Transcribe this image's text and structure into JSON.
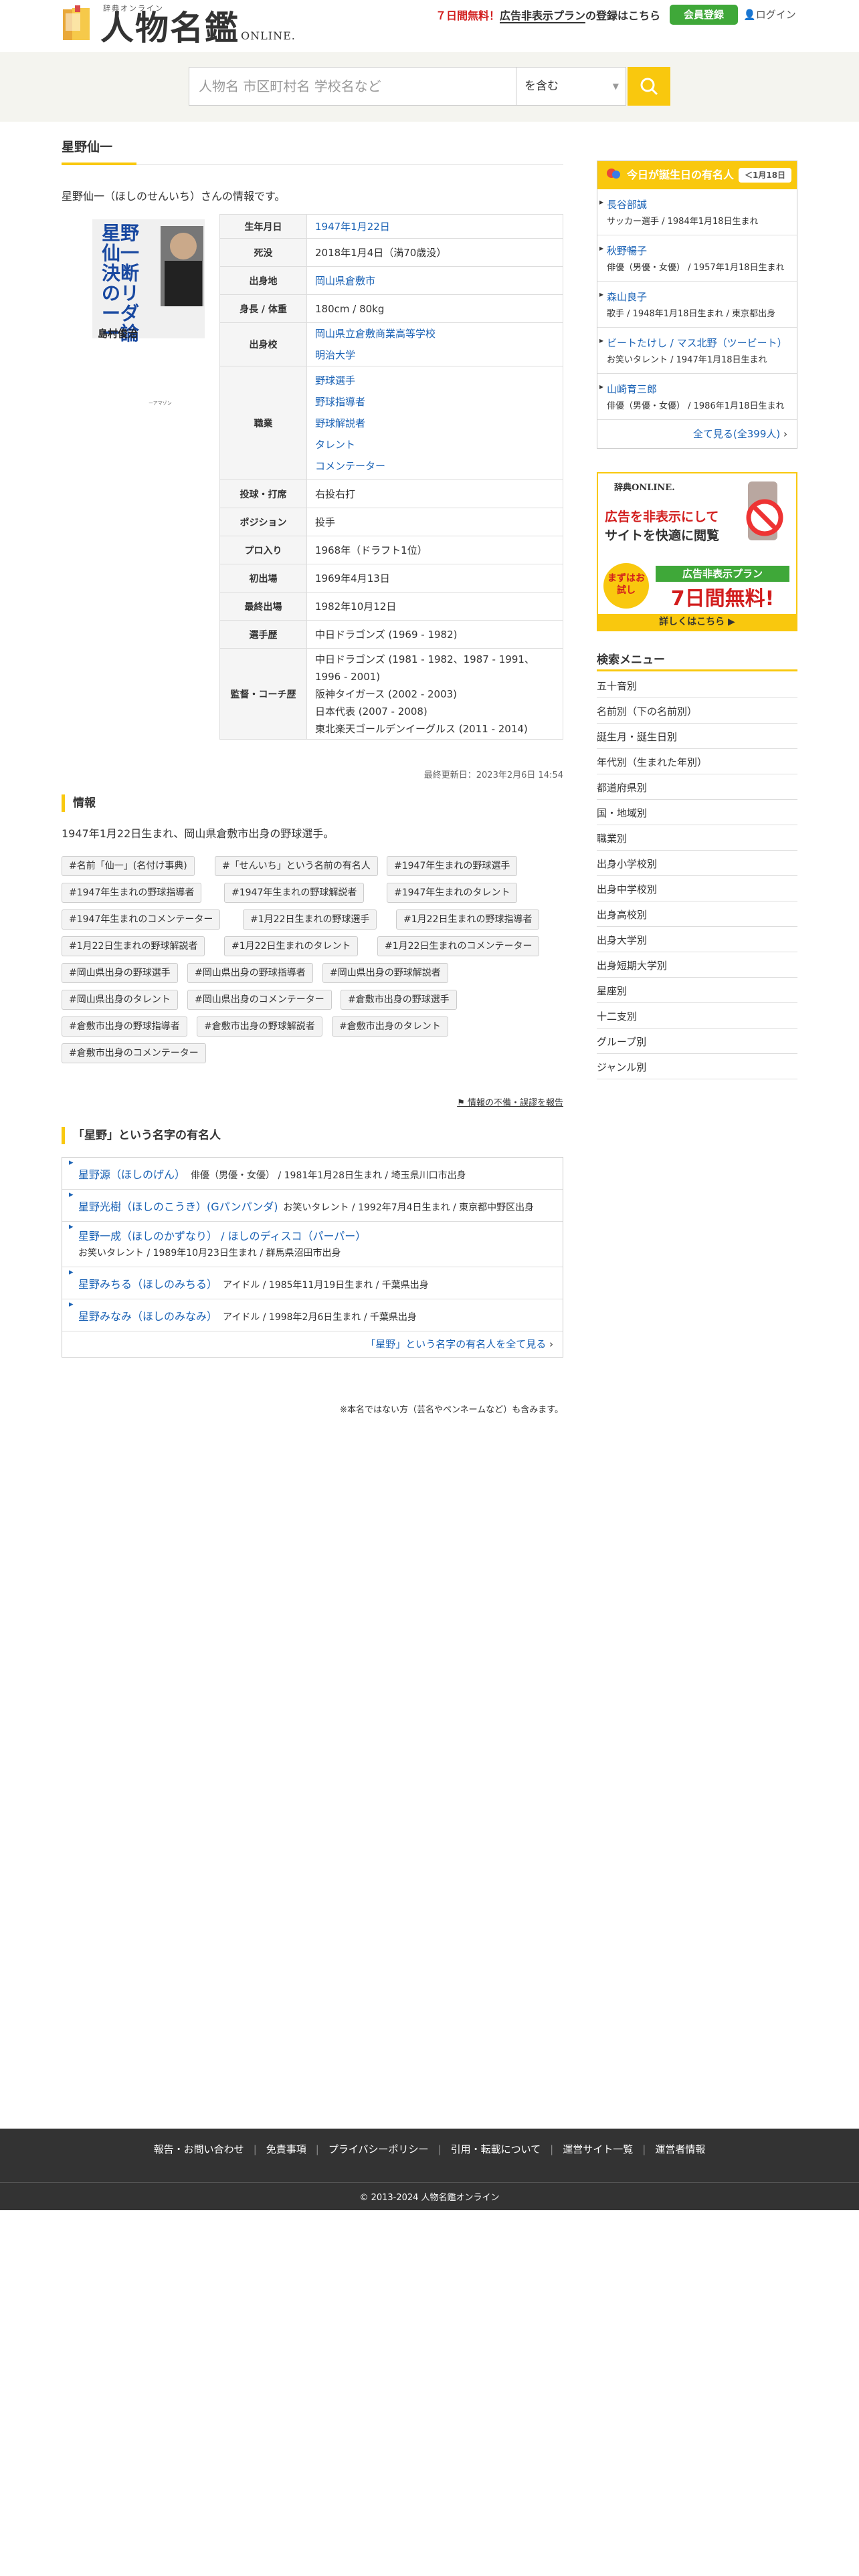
{
  "header": {
    "logo_small": "辞典オンライン",
    "logo_title": "人物名鑑",
    "logo_online": "ONLINE.",
    "promo_red": "７日間無料！",
    "promo_main": "広告非表示プラン",
    "promo_rest": "の登録はこちら",
    "register_label": "会員登録",
    "login_label": "ログイン"
  },
  "search": {
    "placeholder": "人物名 市区町村名 学校名など",
    "mode": "を含む"
  },
  "person": {
    "title": "星野仙一",
    "intro": "星野仙一（ほしのせんいち）さんの情報です。",
    "book_title": "星野仙一 決断のリーダー論",
    "book_author": "島村俊治",
    "book_note": "ーアマゾン",
    "profile": [
      {
        "label": "生年月日",
        "values": [
          "1947年1月22日"
        ],
        "link": true
      },
      {
        "label": "死没",
        "values": [
          "2018年1月4日（満70歳没）"
        ],
        "link": false
      },
      {
        "label": "出身地",
        "values": [
          "岡山県倉敷市"
        ],
        "link": true
      },
      {
        "label": "身長 / 体重",
        "values": [
          "180cm / 80kg"
        ],
        "link": false
      },
      {
        "label": "出身校",
        "values": [
          "岡山県立倉敷商業高等学校",
          "明治大学"
        ],
        "link": true
      },
      {
        "label": "職業",
        "values": [
          "野球選手",
          "野球指導者",
          "野球解説者",
          "タレント",
          "コメンテーター"
        ],
        "link": true
      },
      {
        "label": "投球・打席",
        "values": [
          "右投右打"
        ],
        "link": false
      },
      {
        "label": "ポジション",
        "values": [
          "投手"
        ],
        "link": false
      },
      {
        "label": "プロ入り",
        "values": [
          "1968年（ドラフト1位）"
        ],
        "link": false
      },
      {
        "label": "初出場",
        "values": [
          "1969年4月13日"
        ],
        "link": false
      },
      {
        "label": "最終出場",
        "values": [
          "1982年10月12日"
        ],
        "link": false
      },
      {
        "label": "選手歴",
        "values": [
          "中日ドラゴンズ (1969 - 1982)"
        ],
        "link": false
      },
      {
        "label": "監督・コーチ歴",
        "values": [
          "中日ドラゴンズ (1981 - 1982、1987 - 1991、1996 - 2001)",
          "阪神タイガース (2002 - 2003)",
          "日本代表 (2007 - 2008)",
          "東北楽天ゴールデンイーグルス (2011 - 2014)"
        ],
        "link": false
      }
    ],
    "updated": "最終更新日：2023年2月6日 14:54"
  },
  "info": {
    "heading": "情報",
    "text": "1947年1月22日生まれ、岡山県倉敷市出身の野球選手。",
    "tags": [
      "#名前「仙一」(名付け事典)",
      "#「せんいち」という名前の有名人",
      "#1947年生まれの野球選手",
      "#1947年生まれの野球指導者",
      "#1947年生まれの野球解説者",
      "#1947年生まれのタレント",
      "#1947年生まれのコメンテーター",
      "#1月22日生まれの野球選手",
      "#1月22日生まれの野球指導者",
      "#1月22日生まれの野球解説者",
      "#1月22日生まれのタレント",
      "#1月22日生まれのコメンテーター",
      "#岡山県出身の野球選手",
      "#岡山県出身の野球指導者",
      "#岡山県出身の野球解説者",
      "#岡山県出身のタレント",
      "#岡山県出身のコメンテーター",
      "#倉敷市出身の野球選手",
      "#倉敷市出身の野球指導者",
      "#倉敷市出身の野球解説者",
      "#倉敷市出身のタレント",
      "#倉敷市出身のコメンテーター"
    ],
    "report": "情報の不備・誤謬を報告"
  },
  "namesakes": {
    "heading": "「星野」という名字の有名人",
    "items": [
      {
        "name": "星野源（ほしのげん）",
        "desc": "俳優（男優・女優） / 1981年1月28日生まれ / 埼玉県川口市出身"
      },
      {
        "name": "星野光樹（ほしのこうき）(Gパンパンダ)",
        "desc": "お笑いタレント / 1992年7月4日生まれ / 東京都中野区出身"
      },
      {
        "name": "星野一成（ほしのかずなり） / ほしのディスコ（パーパー）",
        "desc": "お笑いタレント / 1989年10月23日生まれ / 群馬県沼田市出身"
      },
      {
        "name": "星野みちる（ほしのみちる）",
        "desc": "アイドル / 1985年11月19日生まれ / 千葉県出身"
      },
      {
        "name": "星野みなみ（ほしのみなみ）",
        "desc": "アイドル / 1998年2月6日生まれ / 千葉県出身"
      }
    ],
    "all_label": "「星野」という名字の有名人を全て見る",
    "note": "※本名ではない方（芸名やペンネームなど）も含みます。"
  },
  "sidebar": {
    "bday_heading": "今日が誕生日の有名人",
    "bday_date": "＜1月18日",
    "bday_items": [
      {
        "name": "長谷部誠",
        "desc": "サッカー選手 / 1984年1月18日生まれ"
      },
      {
        "name": "秋野暢子",
        "desc": "俳優（男優・女優） / 1957年1月18日生まれ"
      },
      {
        "name": "森山良子",
        "desc": "歌手 / 1948年1月18日生まれ / 東京都出身"
      },
      {
        "name": "ビートたけし / マス北野（ツービート）",
        "desc": "お笑いタレント / 1947年1月18日生まれ"
      },
      {
        "name": "山崎育三郎",
        "desc": "俳優（男優・女優） / 1986年1月18日生まれ"
      }
    ],
    "bday_all": "全て見る(全399人)",
    "ad": {
      "brand": "辞典ONLINE.",
      "line1": "広告を非表示にして",
      "line2": "サイトを快適に閲覧",
      "badge": "まずはお試し",
      "plan": "広告非表示プラン",
      "free": "7日間無料!",
      "cta": "詳しくはこちら ▶"
    },
    "menu_heading": "検索メニュー",
    "menu_items": [
      "五十音別",
      "名前別（下の名前別）",
      "誕生月・誕生日別",
      "年代別（生まれた年別）",
      "都道府県別",
      "国・地域別",
      "職業別",
      "出身小学校別",
      "出身中学校別",
      "出身高校別",
      "出身大学別",
      "出身短期大学別",
      "星座別",
      "十二支別",
      "グループ別",
      "ジャンル別"
    ]
  },
  "footer": {
    "links": [
      "報告・お問い合わせ",
      "免責事項",
      "プライバシーポリシー",
      "引用・転載について",
      "運営サイト一覧",
      "運営者情報"
    ],
    "copyright": "© 2013-2024 人物名鑑オンライン"
  },
  "colors": {
    "accent": "#f9c80e",
    "link": "#1a62b5",
    "register": "#3fa839",
    "footer": "#333333"
  }
}
